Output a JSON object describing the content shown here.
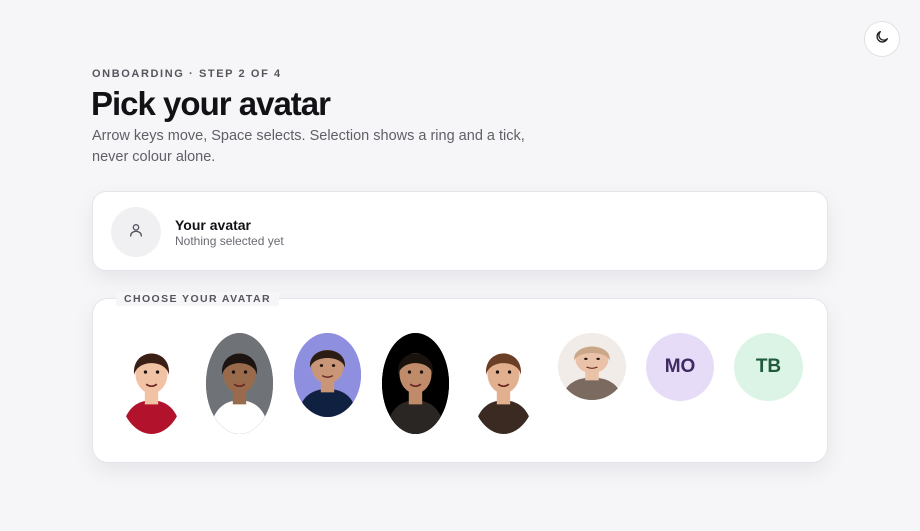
{
  "header": {
    "eyebrow": "ONBOARDING · STEP 2 OF 4",
    "title": "Pick your avatar",
    "subtitle": "Arrow keys move, Space selects. Selection shows a ring and a tick, never colour alone."
  },
  "theme_toggle": {
    "icon": "moon-icon"
  },
  "current": {
    "title": "Your avatar",
    "status": "Nothing selected yet",
    "icon": "user-icon"
  },
  "chooser": {
    "legend": "CHOOSE YOUR AVATAR",
    "options": [
      {
        "kind": "photo",
        "skin": "#f2c2a4",
        "hair": "#3a1f17",
        "shirt": "#b3122c",
        "bg": "#ffffff"
      },
      {
        "kind": "photo",
        "skin": "#9a6a4c",
        "hair": "#1b1410",
        "shirt": "#ffffff",
        "bg": "#6f7378"
      },
      {
        "kind": "photo",
        "skin": "#c99778",
        "hair": "#2b1c14",
        "shirt": "#102040",
        "bg": "#8f8fe0"
      },
      {
        "kind": "photo",
        "skin": "#c08b6a",
        "hair": "#1a120d",
        "shirt": "#2a2624",
        "bg": "#000000"
      },
      {
        "kind": "photo",
        "skin": "#e3b08f",
        "hair": "#6a3f26",
        "shirt": "#3a2a22",
        "bg": "#ffffff"
      },
      {
        "kind": "photo",
        "skin": "#eac2a8",
        "hair": "#c9a788",
        "shirt": "#7a6a60",
        "bg": "#f2ece8"
      },
      {
        "kind": "initials",
        "text": "MO",
        "bg": "#e6dcf7",
        "fg": "#3f2a63"
      },
      {
        "kind": "initials",
        "text": "TB",
        "bg": "#dcf4e6",
        "fg": "#1f5a3a"
      }
    ]
  }
}
